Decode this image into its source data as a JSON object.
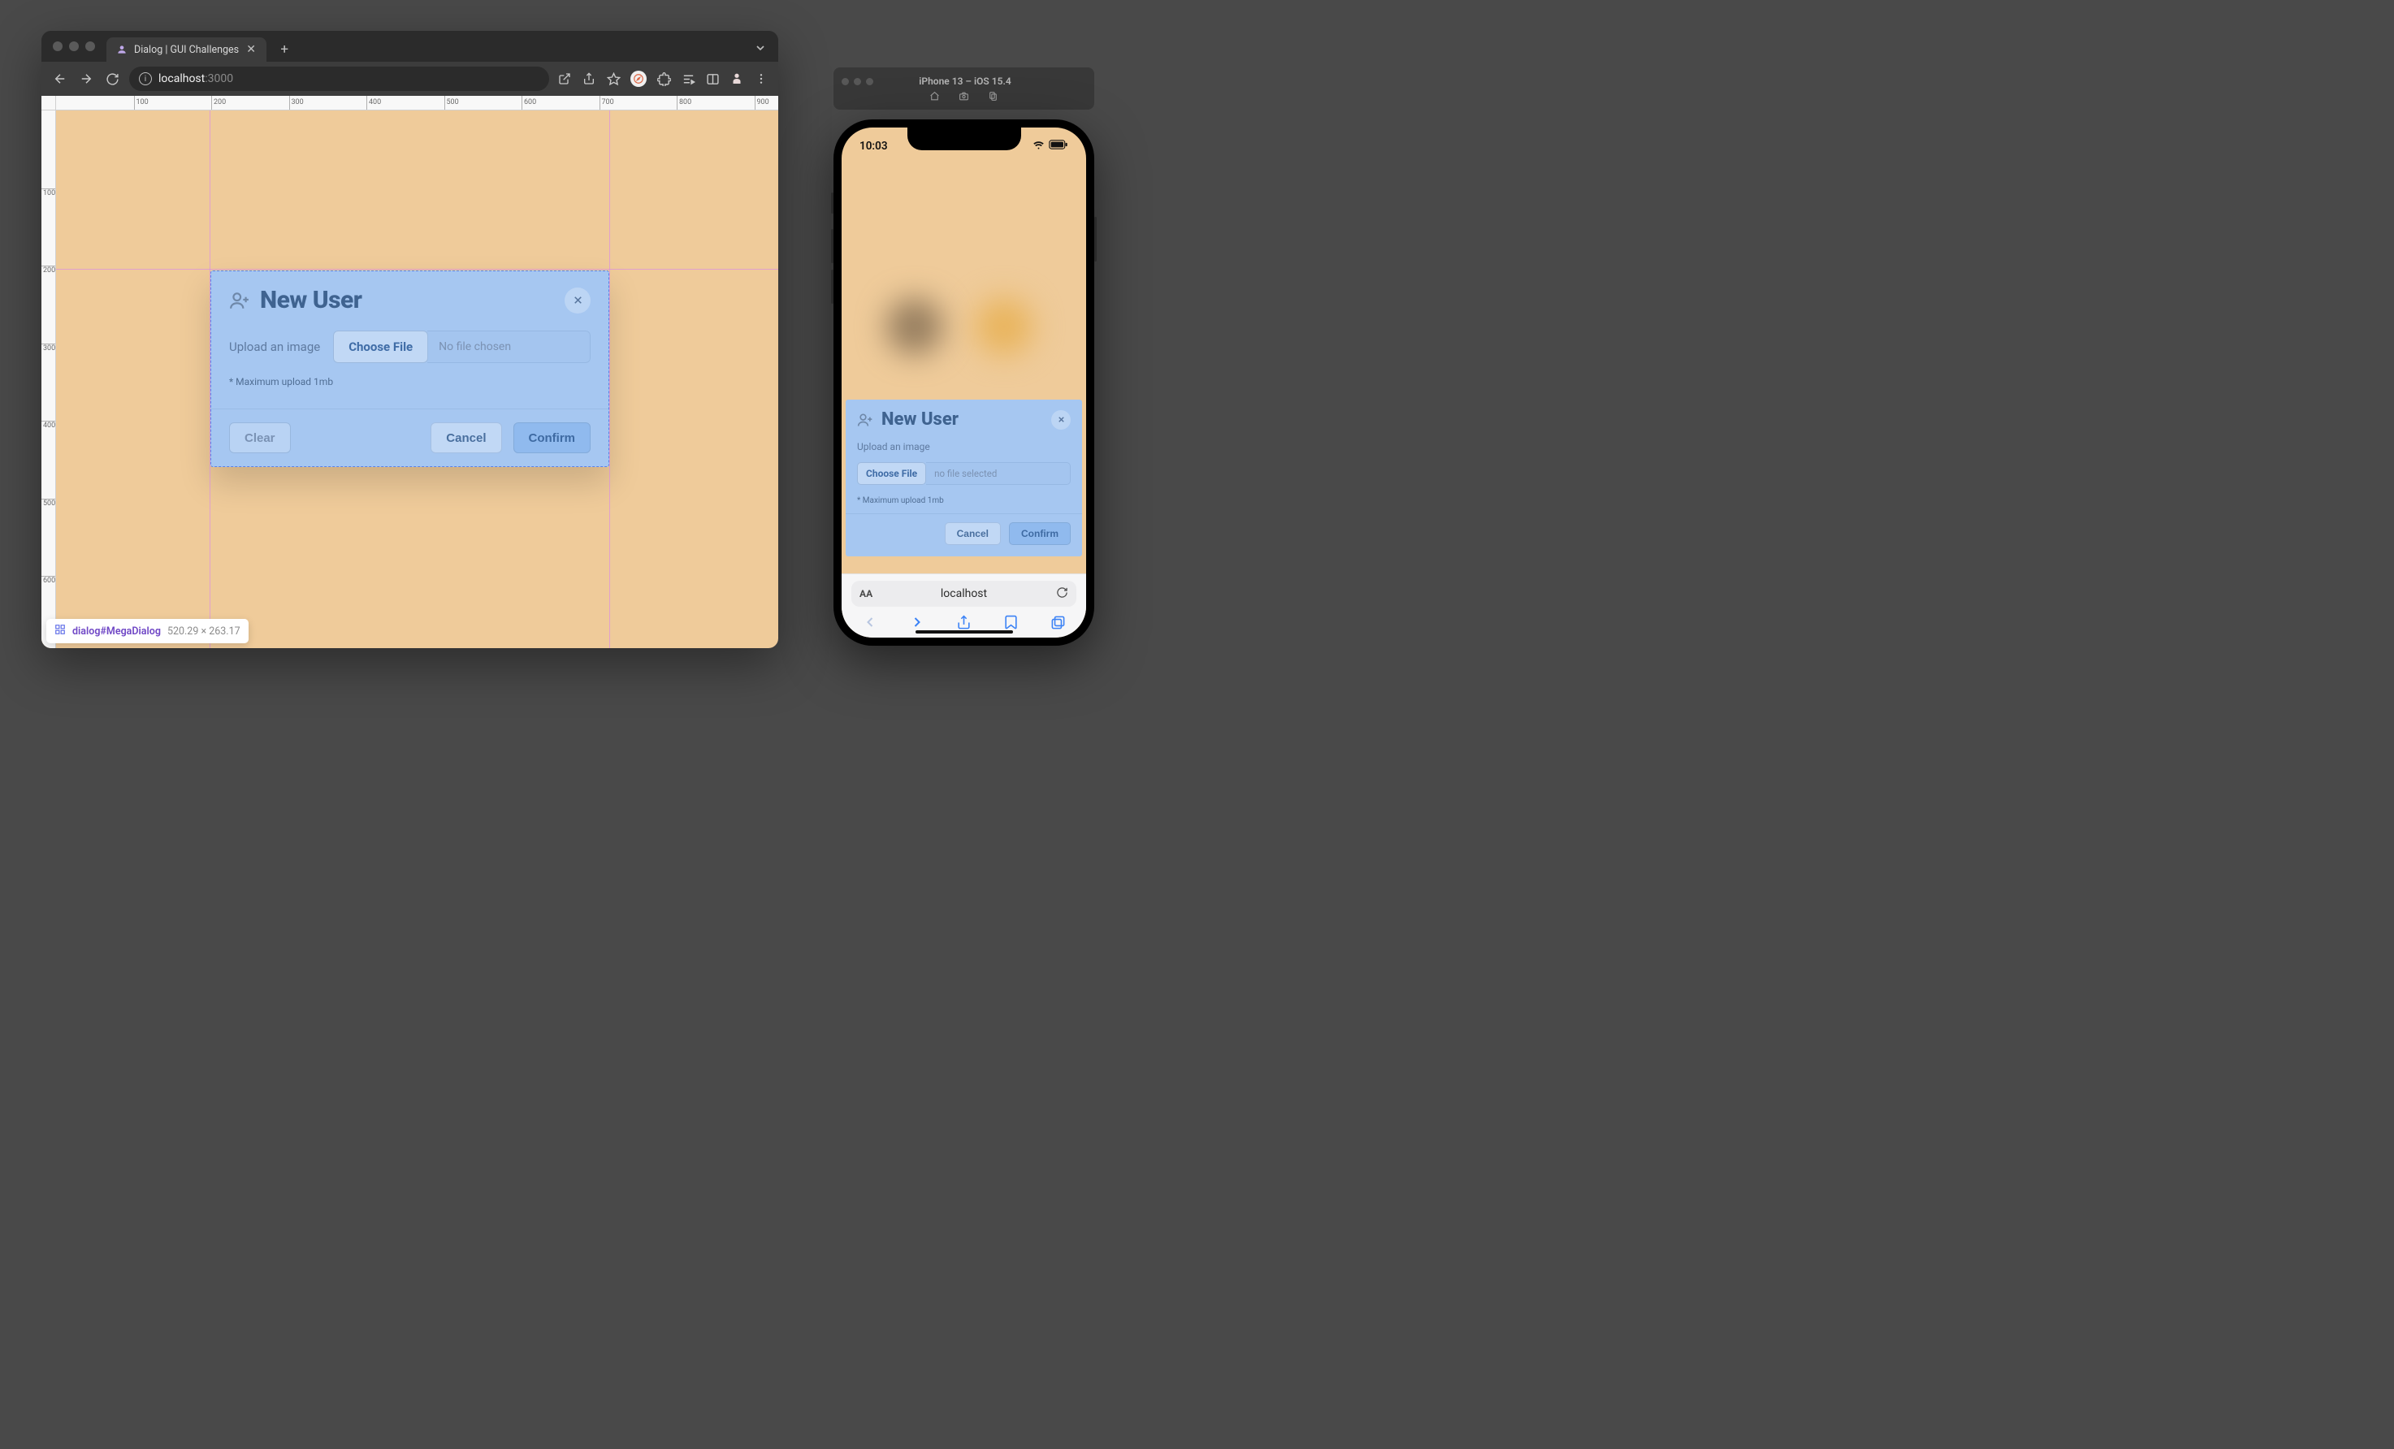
{
  "browser": {
    "tab_title": "Dialog | GUI Challenges",
    "url_host": "localhost",
    "url_port": ":3000"
  },
  "rulers": {
    "h_ticks": [
      100,
      200,
      300,
      400,
      500,
      600,
      700,
      800,
      900
    ],
    "v_ticks": [
      100,
      200,
      300,
      400,
      500,
      600
    ]
  },
  "dialog": {
    "title": "New User",
    "upload_label": "Upload an image",
    "choose_file": "Choose File",
    "no_file": "No file chosen",
    "hint": "* Maximum upload 1mb",
    "clear": "Clear",
    "cancel": "Cancel",
    "confirm": "Confirm"
  },
  "inspector": {
    "selector": "dialog#MegaDialog",
    "dimensions": "520.29 × 263.17"
  },
  "simulator": {
    "title": "iPhone 13 – iOS 15.4",
    "time": "10:03",
    "safari_host": "localhost",
    "aa": "AA"
  },
  "phone_dialog": {
    "title": "New User",
    "upload_label": "Upload an image",
    "choose_file": "Choose File",
    "no_file": "no file selected",
    "hint": "* Maximum upload 1mb",
    "cancel": "Cancel",
    "confirm": "Confirm"
  }
}
